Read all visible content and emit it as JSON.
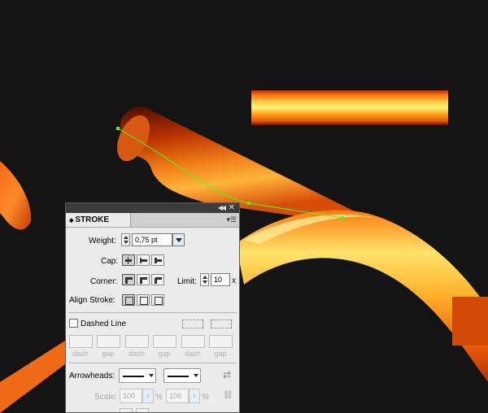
{
  "panel": {
    "title": "STROKE",
    "collapse_icon": "double-chevron-left-icon",
    "close_icon": "close-icon",
    "menu_icon": "panel-menu-icon",
    "weight": {
      "label": "Weight:",
      "value": "0,75 pt"
    },
    "cap": {
      "label": "Cap:",
      "options": [
        "butt-cap-icon",
        "round-cap-icon",
        "projecting-cap-icon"
      ]
    },
    "corner": {
      "label": "Corner:",
      "options": [
        "miter-join-icon",
        "round-join-icon",
        "bevel-join-icon"
      ]
    },
    "limit": {
      "label": "Limit:",
      "value": "10",
      "unit": "x"
    },
    "align_stroke": {
      "label": "Align Stroke:",
      "options": [
        "align-center-icon",
        "align-inside-icon",
        "align-outside-icon"
      ]
    },
    "dashed_line": {
      "label": "Dashed Line",
      "checked": false
    },
    "dash_labels": [
      "dash",
      "gap",
      "dash",
      "gap",
      "dash",
      "gap"
    ],
    "arrowheads": {
      "label": "Arrowheads:"
    },
    "scale": {
      "label": "Scale:",
      "value1": "100",
      "value2": "100",
      "unit": "%"
    }
  },
  "colors": {
    "canvas_bg": "#141414",
    "orange": "#e85a0c",
    "yellow": "#ffe24a",
    "path": "#3cff1e"
  }
}
